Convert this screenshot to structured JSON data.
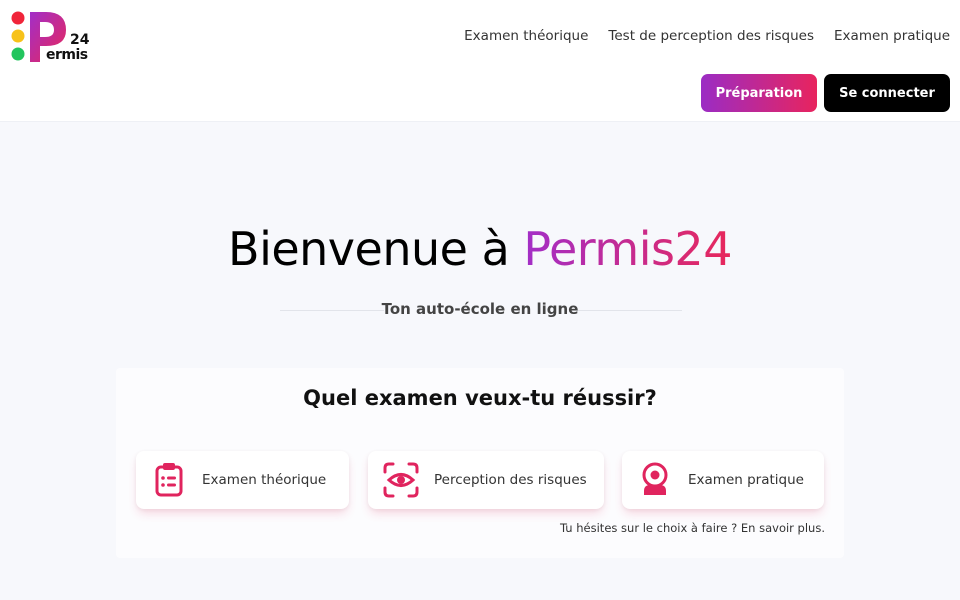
{
  "header": {
    "logo_text": "Permis",
    "logo_number": "24",
    "nav": [
      {
        "label": "Examen théorique"
      },
      {
        "label": "Test de perception des risques"
      },
      {
        "label": "Examen pratique"
      }
    ],
    "prep_label": "Préparation",
    "login_label": "Se connecter"
  },
  "hero": {
    "title_prefix": "Bienvenue à ",
    "title_brand": "Permis24",
    "subtitle": "Ton auto-école en ligne"
  },
  "exam": {
    "heading": "Quel examen veux-tu réussir?",
    "options": [
      {
        "label": "Examen théorique",
        "icon": "clipboard-icon"
      },
      {
        "label": "Perception des risques",
        "icon": "eye-scan-icon"
      },
      {
        "label": "Examen pratique",
        "icon": "steering-wheel-icon"
      }
    ],
    "hint": "Tu hésites sur le choix à faire ? En savoir plus."
  },
  "colors": {
    "accent_start": "#a22ec8",
    "accent_end": "#e8285a",
    "icon": "#e0245e",
    "traffic_red": "#f0253a",
    "traffic_yellow": "#f7c21a",
    "traffic_green": "#22c55e"
  }
}
